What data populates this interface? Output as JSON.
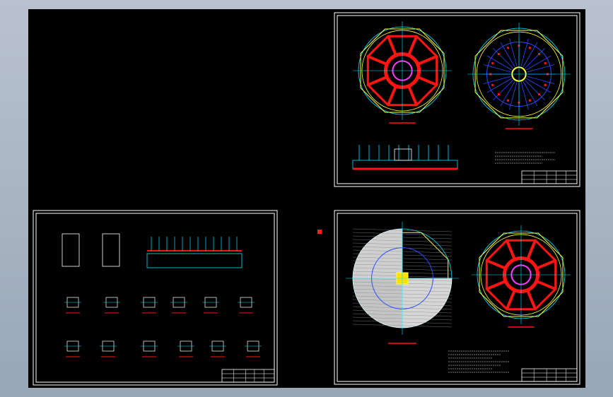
{
  "viewport": {
    "background": "#000000",
    "page_background": "#a9b5c3"
  },
  "colors": {
    "frame": "#ffffff",
    "red": "#ff1414",
    "cyan": "#00e5ff",
    "yellow": "#ffff33",
    "blue": "#2b4dff",
    "magenta": "#ff3bff",
    "white": "#ffffff"
  },
  "sheets": [
    {
      "name": "sheet-top-right",
      "content": "dome-plans-and-section"
    },
    {
      "name": "sheet-bottom-left",
      "content": "section-and-node-details"
    },
    {
      "name": "sheet-bottom-right",
      "content": "reinforcement-plans"
    }
  ],
  "cursor": {
    "color": "#ff1a1a"
  }
}
